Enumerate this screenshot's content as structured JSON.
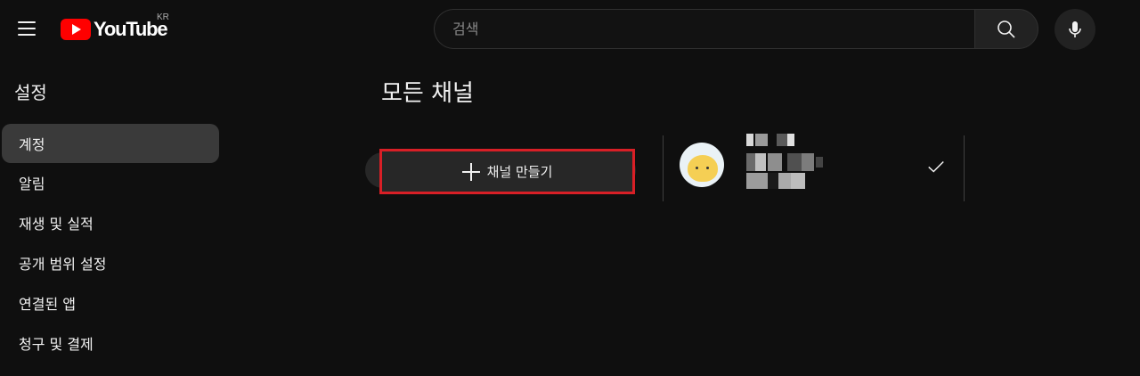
{
  "header": {
    "logo_text": "YouTube",
    "region": "KR",
    "search_placeholder": "검색",
    "icons": [
      "menu-icon",
      "youtube-logo",
      "search-icon",
      "mic-icon"
    ]
  },
  "sidebar": {
    "title": "설정",
    "items": [
      {
        "label": "계정",
        "active": true
      },
      {
        "label": "알림",
        "active": false
      },
      {
        "label": "재생 및 실적",
        "active": false
      },
      {
        "label": "공개 범위 설정",
        "active": false
      },
      {
        "label": "연결된 앱",
        "active": false
      },
      {
        "label": "청구 및 결제",
        "active": false
      }
    ]
  },
  "main": {
    "title": "모든 채널",
    "create_channel_label": "채널 만들기",
    "channel": {
      "name_obscured": true,
      "selected": true
    }
  },
  "colors": {
    "background": "#0f0f0f",
    "accent_red": "#ff0000",
    "highlight_border": "#d81f26"
  }
}
